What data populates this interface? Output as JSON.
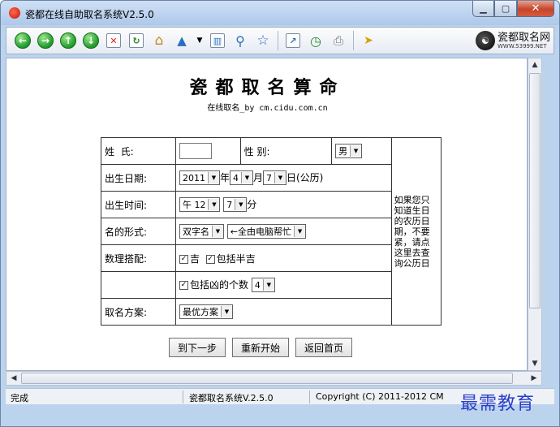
{
  "window": {
    "title": "瓷都在线自助取名系统V2.5.0"
  },
  "toolbar": {
    "logo_text": "瓷都取名网",
    "logo_sub": "WWW.53999.NET"
  },
  "page": {
    "heading": "瓷都取名算命",
    "subheading": "在线取名_by cm.cidu.com.cn"
  },
  "form": {
    "surname_label": "姓  氏:",
    "surname_value": "",
    "gender_label": "性  别:",
    "gender_value": "男",
    "birthdate_label": "出生日期:",
    "year": "2011",
    "year_unit": "年",
    "month": "4",
    "month_unit": "月",
    "day": "7",
    "day_unit": "日(公历)",
    "birthtime_label": "出生时间:",
    "hour": "午 12",
    "minute": "7",
    "minute_unit": "分",
    "name_form_label": "名的形式:",
    "name_form_value": "双字名",
    "helper_value": "←全由电脑帮忙",
    "numerology_label": "数理搭配:",
    "opt_ji": "吉",
    "opt_banji": "包括半吉",
    "opt_xiong": "包括凶的个数",
    "xiong_count": "4",
    "plan_label": "取名方案:",
    "plan_value": "最优方案",
    "note": "如果您只知道生日的农历日期，不要紧，请点这里去查询公历日"
  },
  "buttons": {
    "next": "到下一步",
    "restart": "重新开始",
    "home": "返回首页"
  },
  "status": {
    "left": "完成",
    "mid": "瓷都取名系统V.2.5.0",
    "right": "Copyright (C) 2011-2012 CM"
  },
  "watermark": "最需教育"
}
